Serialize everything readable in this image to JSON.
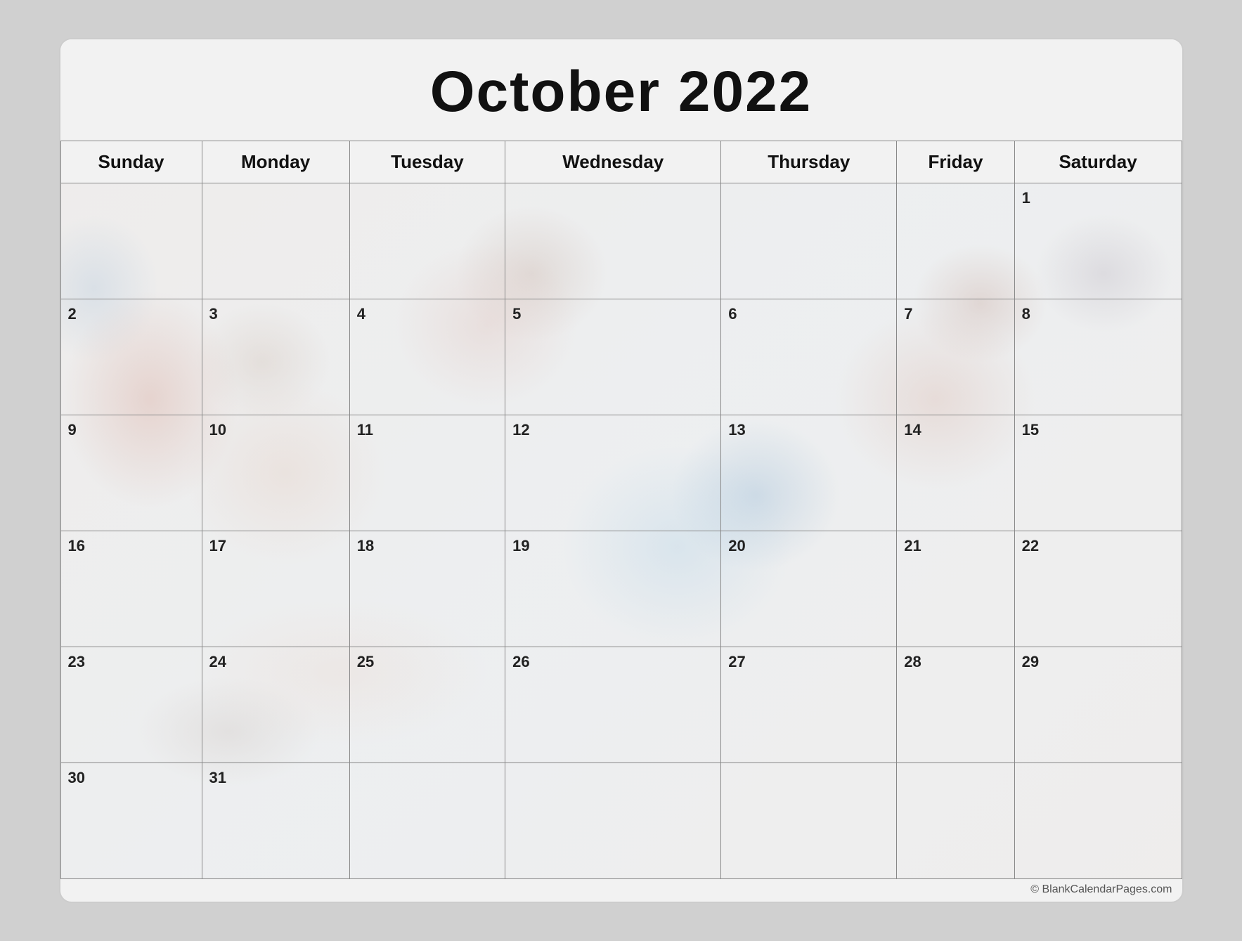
{
  "calendar": {
    "title": "October 2022",
    "month": "October",
    "year": "2022",
    "watermark": "© BlankCalendarPages.com",
    "days_of_week": [
      "Sunday",
      "Monday",
      "Tuesday",
      "Wednesday",
      "Thursday",
      "Friday",
      "Saturday"
    ],
    "weeks": [
      [
        {
          "date": "",
          "empty": true
        },
        {
          "date": "",
          "empty": true
        },
        {
          "date": "",
          "empty": true
        },
        {
          "date": "",
          "empty": true
        },
        {
          "date": "",
          "empty": true
        },
        {
          "date": "",
          "empty": true
        },
        {
          "date": "1"
        }
      ],
      [
        {
          "date": "2"
        },
        {
          "date": "3"
        },
        {
          "date": "4"
        },
        {
          "date": "5"
        },
        {
          "date": "6"
        },
        {
          "date": "7"
        },
        {
          "date": "8"
        }
      ],
      [
        {
          "date": "9"
        },
        {
          "date": "10"
        },
        {
          "date": "11"
        },
        {
          "date": "12"
        },
        {
          "date": "13"
        },
        {
          "date": "14"
        },
        {
          "date": "15"
        }
      ],
      [
        {
          "date": "16"
        },
        {
          "date": "17"
        },
        {
          "date": "18"
        },
        {
          "date": "19"
        },
        {
          "date": "20"
        },
        {
          "date": "21"
        },
        {
          "date": "22"
        }
      ],
      [
        {
          "date": "23"
        },
        {
          "date": "24"
        },
        {
          "date": "25"
        },
        {
          "date": "26"
        },
        {
          "date": "27"
        },
        {
          "date": "28"
        },
        {
          "date": "29"
        }
      ],
      [
        {
          "date": "30"
        },
        {
          "date": "31"
        },
        {
          "date": "",
          "empty": true
        },
        {
          "date": "",
          "empty": true
        },
        {
          "date": "",
          "empty": true
        },
        {
          "date": "",
          "empty": true
        },
        {
          "date": "",
          "empty": true
        }
      ]
    ]
  }
}
